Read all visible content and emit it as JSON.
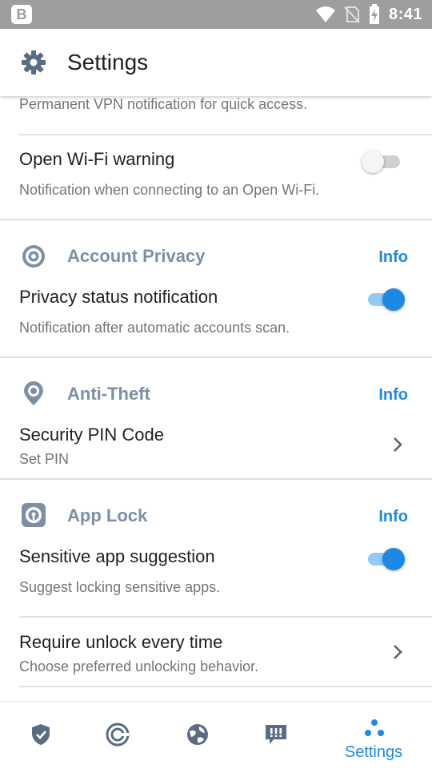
{
  "status_bar": {
    "app_badge": "B",
    "time": "8:41",
    "icons": [
      "wifi-icon",
      "no-sim-icon",
      "battery-charging-icon"
    ]
  },
  "app_bar": {
    "icon": "gear-icon",
    "title": "Settings"
  },
  "vpn_notification": {
    "description": "Permanent VPN notification for quick access."
  },
  "open_wifi_warning": {
    "title": "Open Wi-Fi warning",
    "description": "Notification when connecting to an Open Wi-Fi.",
    "enabled": false
  },
  "account_privacy": {
    "section_title": "Account Privacy",
    "icon": "eye-icon",
    "info_label": "Info",
    "privacy_status": {
      "title": "Privacy status notification",
      "description": "Notification after automatic accounts scan.",
      "enabled": true
    }
  },
  "anti_theft": {
    "section_title": "Anti-Theft",
    "icon": "location-pin-icon",
    "info_label": "Info",
    "pin_code": {
      "title": "Security PIN Code",
      "description": "Set PIN"
    }
  },
  "app_lock": {
    "section_title": "App Lock",
    "icon": "app-lock-icon",
    "info_label": "Info",
    "sensitive_app": {
      "title": "Sensitive app suggestion",
      "description": "Suggest locking sensitive apps.",
      "enabled": true
    },
    "require_unlock": {
      "title": "Require unlock every time",
      "description": "Choose preferred unlocking behavior."
    }
  },
  "bottom_nav": {
    "items": [
      {
        "icon": "shield-icon",
        "label": ""
      },
      {
        "icon": "privacy-icon",
        "label": ""
      },
      {
        "icon": "globe-icon",
        "label": ""
      },
      {
        "icon": "chat-alert-icon",
        "label": ""
      },
      {
        "icon": "dots-icon",
        "label": "Settings",
        "active": true
      }
    ]
  },
  "colors": {
    "accent": "#1e88e5",
    "section_title": "#7d8fa6",
    "status_bar": "#9e9e9e"
  }
}
